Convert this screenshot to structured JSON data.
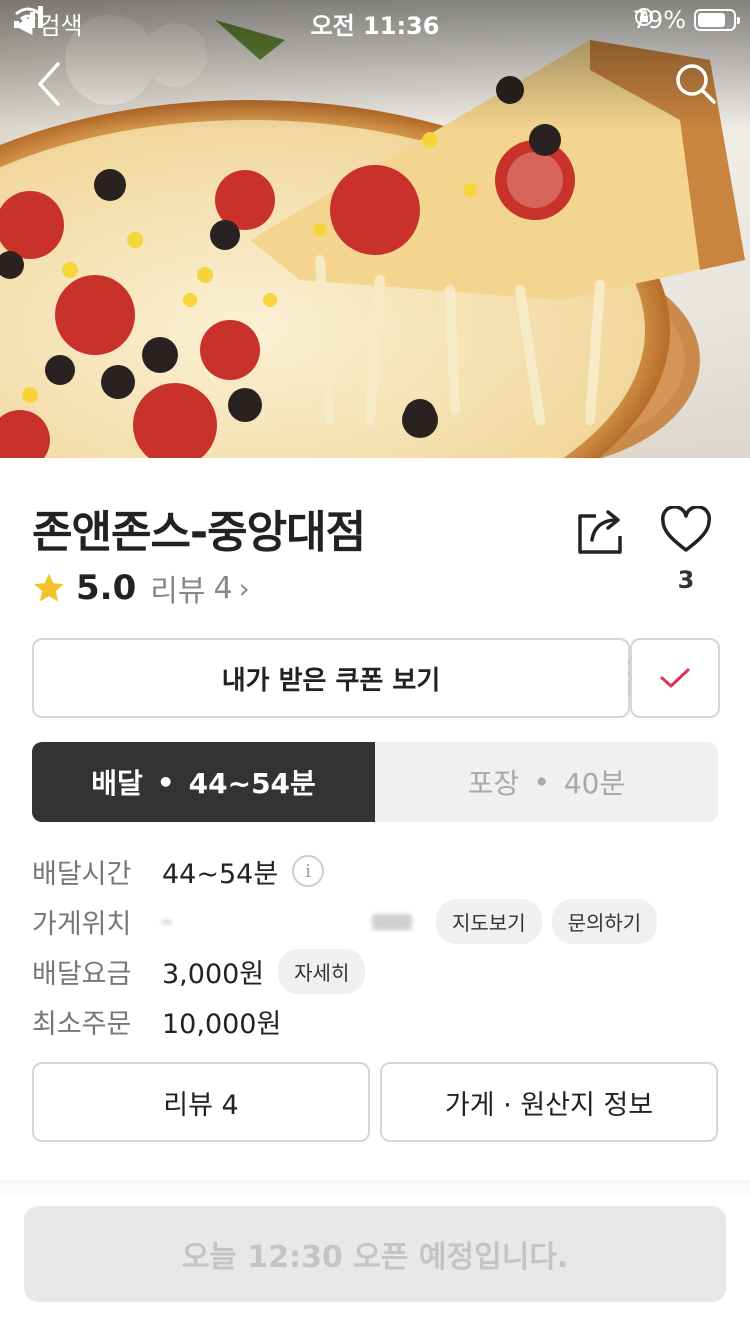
{
  "status_bar": {
    "back_app": "검색",
    "time": "오전 11:36",
    "battery": "79%",
    "battery_level": 0.79
  },
  "store": {
    "name": "존앤존스-중앙대점",
    "rating": "5.0",
    "review_label": "리뷰",
    "review_count": "4",
    "like_count": "3"
  },
  "coupon": {
    "label": "내가 받은 쿠폰 보기"
  },
  "mode_tabs": [
    {
      "label": "배달",
      "time": "44~54분",
      "active": true
    },
    {
      "label": "포장",
      "time": "40분",
      "active": false
    }
  ],
  "info": {
    "delivery_time": {
      "label": "배달시간",
      "value": "44~54분"
    },
    "location": {
      "label": "가게위치",
      "map_chip": "지도보기",
      "inquiry_chip": "문의하기"
    },
    "delivery_fee": {
      "label": "배달요금",
      "value": "3,000원",
      "detail_chip": "자세히"
    },
    "min_order": {
      "label": "최소주문",
      "value": "10,000원"
    }
  },
  "buttons": {
    "reviews": "리뷰 4",
    "store_info": "가게 · 원산지 정보"
  },
  "open_notice": "오늘 12:30 오픈 예정입니다.",
  "colors": {
    "active_tab": "#333333",
    "check_accent": "#e0315b",
    "star": "#f7c12e"
  }
}
